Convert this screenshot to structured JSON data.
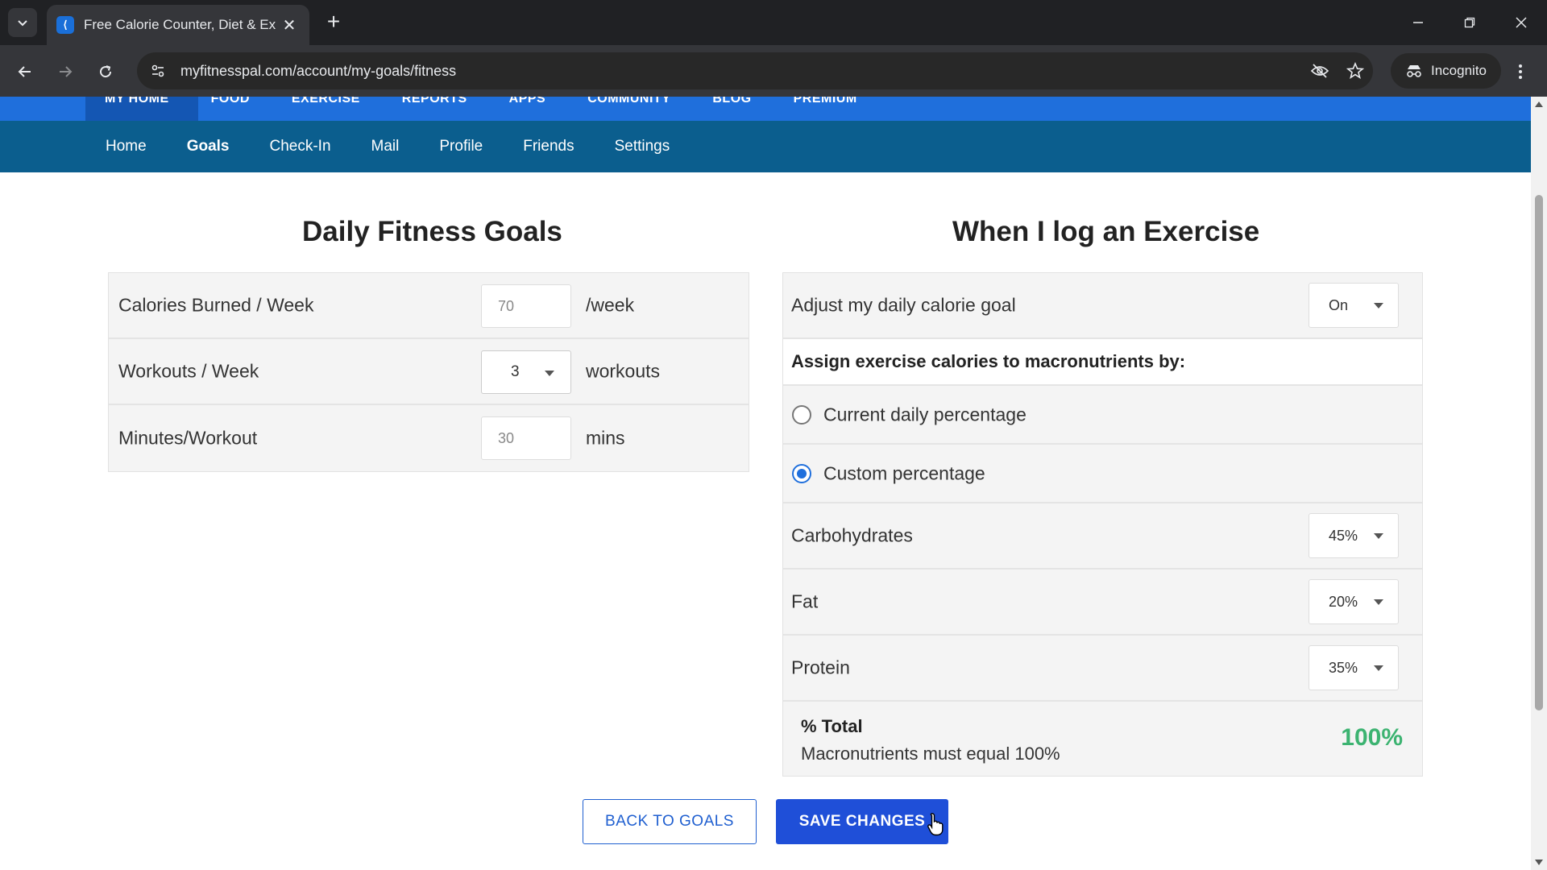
{
  "browser": {
    "tab_title": "Free Calorie Counter, Diet & Ex",
    "url": "myfitnesspal.com/account/my-goals/fitness",
    "incognito_label": "Incognito"
  },
  "topnav": {
    "items": [
      "MY HOME",
      "FOOD",
      "EXERCISE",
      "REPORTS",
      "APPS",
      "COMMUNITY",
      "BLOG",
      "PREMIUM"
    ]
  },
  "subnav": {
    "items": [
      "Home",
      "Goals",
      "Check-In",
      "Mail",
      "Profile",
      "Friends",
      "Settings"
    ],
    "active": "Goals"
  },
  "fitness_goals": {
    "title": "Daily Fitness Goals",
    "rows": [
      {
        "label": "Calories Burned / Week",
        "value": "70",
        "unit": "/week"
      },
      {
        "label": "Workouts / Week",
        "value": "3",
        "unit": "workouts"
      },
      {
        "label": "Minutes/Workout",
        "value": "30",
        "unit": "mins"
      }
    ]
  },
  "exercise_log": {
    "title": "When I log an Exercise",
    "adjust_label": "Adjust my daily calorie goal",
    "adjust_value": "On",
    "assign_label": "Assign exercise calories to macronutrients by:",
    "option_current": "Current daily percentage",
    "option_custom": "Custom percentage",
    "selected_option": "Custom percentage",
    "macros": [
      {
        "label": "Carbohydrates",
        "value": "45%"
      },
      {
        "label": "Fat",
        "value": "20%"
      },
      {
        "label": "Protein",
        "value": "35%"
      }
    ],
    "total_title": "% Total",
    "total_note": "Macronutrients must equal 100%",
    "total_value": "100%",
    "total_color": "#3cb371"
  },
  "actions": {
    "back_label": "BACK TO GOALS",
    "save_label": "SAVE CHANGES"
  }
}
